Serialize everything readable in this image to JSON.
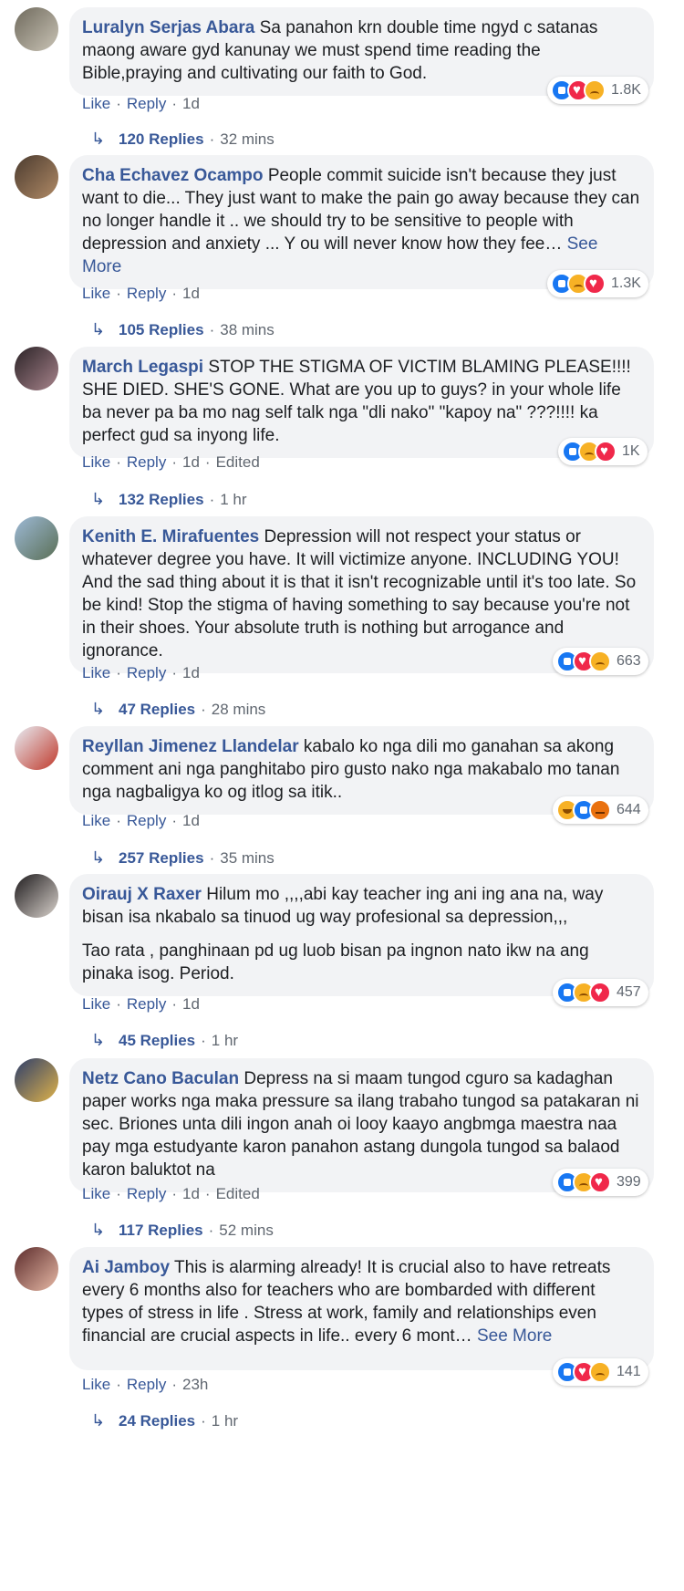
{
  "comments": [
    {
      "author": "Luralyn Serjas Abara",
      "text": [
        "Sa panahon krn double time ngyd c satanas maong aware gyd kanunay we must spend time reading the Bible,praying and cultivating our faith to God."
      ],
      "see_more": "",
      "reactions": [
        "like",
        "love",
        "sad"
      ],
      "reaction_count": "1.8K",
      "like": "Like",
      "reply": "Reply",
      "time": "1d",
      "edited": "",
      "replies_label": "120 Replies",
      "replies_time": "32 mins",
      "avatar_colors": [
        "#6f6a5d",
        "#c9c3b5"
      ]
    },
    {
      "author": "Cha Echavez Ocampo",
      "text": [
        "People commit suicide isn't because they just want to die... They just want to make the pain go away because they can no longer handle it .. we should try to be sensitive to people with depression and anxiety ... Y ou will never know how they fee…"
      ],
      "see_more": "See More",
      "reactions": [
        "like",
        "sad",
        "love"
      ],
      "reaction_count": "1.3K",
      "like": "Like",
      "reply": "Reply",
      "time": "1d",
      "edited": "",
      "replies_label": "105 Replies",
      "replies_time": "38 mins",
      "avatar_colors": [
        "#4b3b2f",
        "#b08a66"
      ]
    },
    {
      "author": "March Legaspi",
      "text": [
        "STOP THE STIGMA OF VICTIM BLAMING PLEASE!!!! SHE DIED. SHE'S GONE. What are you up to guys? in your whole life ba never pa ba mo nag self talk nga \"dli nako\" \"kapoy na\" ???!!!! ka perfect gud sa inyong life."
      ],
      "see_more": "",
      "reactions": [
        "like",
        "sad",
        "love"
      ],
      "reaction_count": "1K",
      "like": "Like",
      "reply": "Reply",
      "time": "1d",
      "edited": "Edited",
      "replies_label": "132 Replies",
      "replies_time": "1 hr",
      "avatar_colors": [
        "#2a2226",
        "#a8848c"
      ]
    },
    {
      "author": "Kenith E. Mirafuentes",
      "text": [
        "Depression will not respect your status or whatever degree you have. It will victimize anyone. INCLUDING YOU! And the sad thing about it is that it isn't recognizable until it's too late. So be kind! Stop the stigma of having something to say because you're not in their shoes. Your absolute truth is nothing but arrogance and ignorance."
      ],
      "see_more": "",
      "reactions": [
        "like",
        "love",
        "sad"
      ],
      "reaction_count": "663",
      "like": "Like",
      "reply": "Reply",
      "time": "1d",
      "edited": "",
      "replies_label": "47 Replies",
      "replies_time": "28 mins",
      "avatar_colors": [
        "#9db9d6",
        "#5a6f55"
      ]
    },
    {
      "author": "Reyllan Jimenez Llandelar",
      "text": [
        "kabalo ko nga dili mo ganahan sa akong comment ani nga panghitabo piro gusto nako nga makabalo mo tanan nga nagbaligya ko og itlog sa itik.."
      ],
      "see_more": "",
      "reactions": [
        "haha",
        "like",
        "angry"
      ],
      "reaction_count": "644",
      "like": "Like",
      "reply": "Reply",
      "time": "1d",
      "edited": "",
      "replies_label": "257 Replies",
      "replies_time": "35 mins",
      "avatar_colors": [
        "#e8eef5",
        "#c0392b"
      ]
    },
    {
      "author": "Oirauj X Raxer",
      "text": [
        "Hilum mo ,,,,abi kay teacher ing ani ing ana na, way bisan isa nkabalo sa tinuod ug way profesional sa depression,,,",
        "Tao rata , panghinaan pd ug luob bisan pa ingnon nato ikw na ang pinaka isog. Period."
      ],
      "see_more": "",
      "reactions": [
        "like",
        "sad",
        "love"
      ],
      "reaction_count": "457",
      "like": "Like",
      "reply": "Reply",
      "time": "1d",
      "edited": "",
      "replies_label": "45 Replies",
      "replies_time": "1 hr",
      "avatar_colors": [
        "#1e1b1d",
        "#d9d2cc"
      ]
    },
    {
      "author": "Netz Cano Baculan",
      "text": [
        "Depress na si maam tungod cguro sa kadaghan paper works nga maka pressure sa ilang trabaho tungod sa patakaran ni sec. Briones unta dili ingon anah oi looy kaayo angbmga maestra naa pay mga estudyante karon panahon astang dungola tungod sa balaod karon baluktot na"
      ],
      "see_more": "",
      "reactions": [
        "like",
        "sad",
        "love"
      ],
      "reaction_count": "399",
      "like": "Like",
      "reply": "Reply",
      "time": "1d",
      "edited": "Edited",
      "replies_label": "117 Replies",
      "replies_time": "52 mins",
      "avatar_colors": [
        "#2d3e6b",
        "#e0b34a"
      ]
    },
    {
      "author": "Ai Jamboy",
      "text": [
        "This is alarming already! It is crucial also to have retreats every 6 months also for teachers who are bombarded with different types of stress in life . Stress at work, family and relationships even financial are crucial aspects in life.. every 6 mont…"
      ],
      "see_more": "See More",
      "reactions": [
        "like",
        "love",
        "sad"
      ],
      "reaction_count": "141",
      "like": "Like",
      "reply": "Reply",
      "time": "23h",
      "edited": "",
      "replies_label": "24 Replies",
      "replies_time": "1 hr",
      "avatar_colors": [
        "#5b2b2b",
        "#e7b9a6"
      ]
    }
  ],
  "colors": {
    "link": "#385898",
    "meta": "#606770",
    "bubble": "#f2f3f5"
  }
}
